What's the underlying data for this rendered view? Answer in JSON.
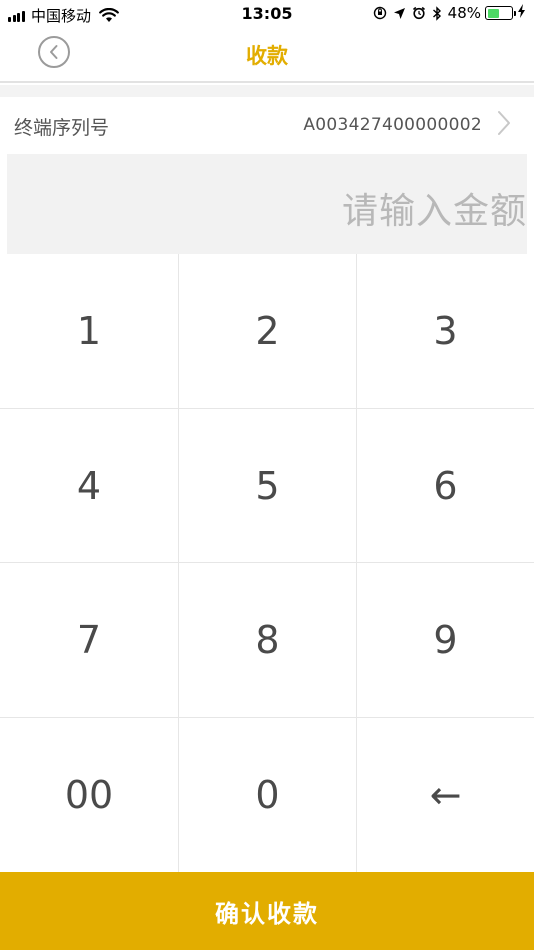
{
  "status_bar": {
    "carrier": "中国移动",
    "time": "13:05",
    "battery_percent": "48%",
    "battery_level": 0.48,
    "icons": [
      "signal-icon",
      "wifi-icon",
      "orientation-lock-icon",
      "location-icon",
      "alarm-icon",
      "bluetooth-icon",
      "battery-icon",
      "charging-icon"
    ]
  },
  "nav": {
    "title": "收款",
    "back_icon": "chevron-left-circle-icon"
  },
  "terminal": {
    "label": "终端序列号",
    "value": "A003427400000002",
    "chevron_icon": "chevron-right-icon"
  },
  "amount": {
    "placeholder": "请输入金额"
  },
  "keypad": {
    "keys": [
      "1",
      "2",
      "3",
      "4",
      "5",
      "6",
      "7",
      "8",
      "9",
      "00",
      "0",
      "←"
    ]
  },
  "confirm": {
    "label": "确认收款"
  },
  "colors": {
    "accent": "#e2ad00",
    "placeholder": "#b8b8b8",
    "text": "#4a4a4a",
    "divider": "#e6e6e6"
  }
}
